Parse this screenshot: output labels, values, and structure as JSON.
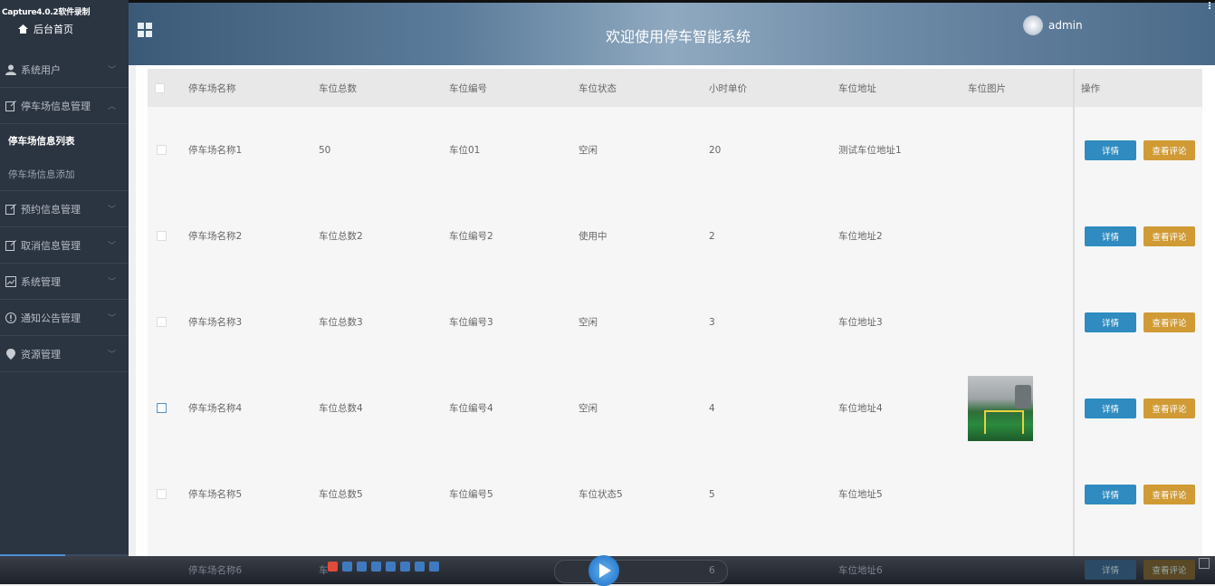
{
  "watermark": "Capture4.0.2软件录制",
  "header": {
    "title": "欢迎使用停车智能系统",
    "user": "admin"
  },
  "sidebar": {
    "home": "后台首页",
    "items": [
      {
        "label": "系统用户",
        "icon": "user-icon"
      },
      {
        "label": "停车场信息管理",
        "icon": "edit-icon",
        "expanded": true,
        "children": [
          {
            "label": "停车场信息列表",
            "active": true
          },
          {
            "label": "停车场信息添加"
          }
        ]
      },
      {
        "label": "预约信息管理",
        "icon": "edit-icon"
      },
      {
        "label": "取消信息管理",
        "icon": "edit-icon"
      },
      {
        "label": "系统管理",
        "icon": "image-icon"
      },
      {
        "label": "通知公告管理",
        "icon": "info-icon"
      },
      {
        "label": "资源管理",
        "icon": "location-icon"
      }
    ]
  },
  "table": {
    "columns": [
      "停车场名称",
      "车位总数",
      "车位编号",
      "车位状态",
      "小时单价",
      "车位地址",
      "车位图片",
      "操作"
    ],
    "rows": [
      [
        "停车场名称1",
        "50",
        "车位01",
        "空闲",
        "20",
        "测试车位地址1",
        ""
      ],
      [
        "停车场名称2",
        "车位总数2",
        "车位编号2",
        "使用中",
        "2",
        "车位地址2",
        ""
      ],
      [
        "停车场名称3",
        "车位总数3",
        "车位编号3",
        "空闲",
        "3",
        "车位地址3",
        ""
      ],
      [
        "停车场名称4",
        "车位总数4",
        "车位编号4",
        "空闲",
        "4",
        "车位地址4",
        "parking-photo"
      ],
      [
        "停车场名称5",
        "车位总数5",
        "车位编号5",
        "车位状态5",
        "5",
        "车位地址5",
        ""
      ]
    ],
    "partial_row": {
      "name": "停车场名称6",
      "count": "车",
      "address": "车位地址6",
      "price": "6"
    },
    "actions": {
      "detail": "详情",
      "review": "查看评论"
    }
  },
  "colors": {
    "sidebar": "#2b3441",
    "detail_button": "#2f8bc0",
    "review_button": "#d09a35"
  }
}
